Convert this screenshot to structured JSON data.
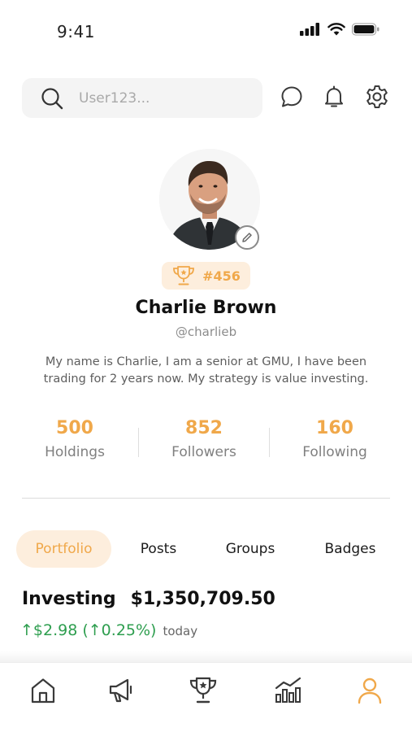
{
  "status_bar": {
    "time": "9:41"
  },
  "search": {
    "placeholder": "User123..."
  },
  "profile": {
    "rank": "#456",
    "name": "Charlie Brown",
    "handle": "@charlieb",
    "bio": "My name is Charlie, I am a senior at GMU, I have been trading for 2 years now. My strategy is value investing."
  },
  "stats": [
    {
      "value": "500",
      "label": "Holdings"
    },
    {
      "value": "852",
      "label": "Followers"
    },
    {
      "value": "160",
      "label": "Following"
    }
  ],
  "tabs": [
    {
      "label": "Portfolio",
      "active": true
    },
    {
      "label": "Posts",
      "active": false
    },
    {
      "label": "Groups",
      "active": false
    },
    {
      "label": "Badges",
      "active": false
    }
  ],
  "portfolio": {
    "label": "Investing",
    "value": "$1,350,709.50",
    "change": "↑$2.98 (↑0.25%)",
    "period": "today"
  },
  "bottom_nav": [
    {
      "icon": "home-icon",
      "active": false
    },
    {
      "icon": "megaphone-icon",
      "active": false
    },
    {
      "icon": "trophy-icon",
      "active": false
    },
    {
      "icon": "chart-icon",
      "active": false
    },
    {
      "icon": "profile-icon",
      "active": true
    }
  ],
  "colors": {
    "accent": "#f0a84a",
    "accent_bg": "#fdeedd",
    "positive": "#2e9e4f",
    "icon": "#3a3a3a"
  }
}
